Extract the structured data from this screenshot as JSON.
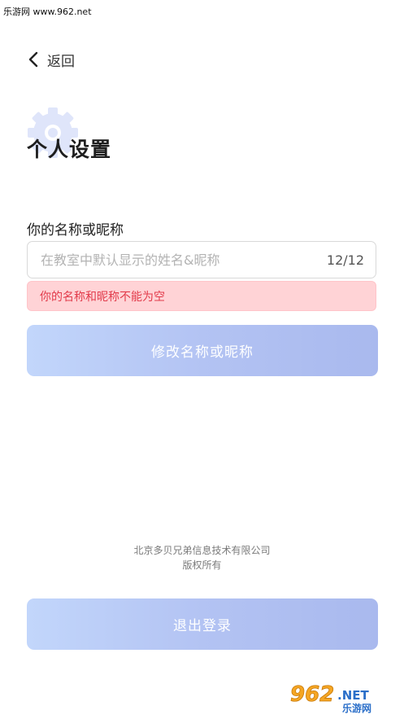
{
  "watermark_top": "乐游网 www.962.net",
  "nav": {
    "back_label": "返回"
  },
  "header": {
    "title": "个人设置"
  },
  "form": {
    "label": "你的名称或昵称",
    "placeholder": "在教室中默认显示的姓名&昵称",
    "value": "",
    "counter": "12/12",
    "error": "你的名称和昵称不能为空",
    "submit_label": "修改名称或昵称"
  },
  "footer": {
    "company": "北京多贝兄弟信息技术有限公司",
    "rights": "版权所有"
  },
  "logout_label": "退出登录",
  "logo_watermark": {
    "brand": "962.NET",
    "tagline": "乐游网"
  },
  "colors": {
    "button_gradient_start": "#c2d6fb",
    "button_gradient_end": "#a9b9ee",
    "error_bg": "#ffd3d6",
    "error_text": "#e23b4b"
  }
}
